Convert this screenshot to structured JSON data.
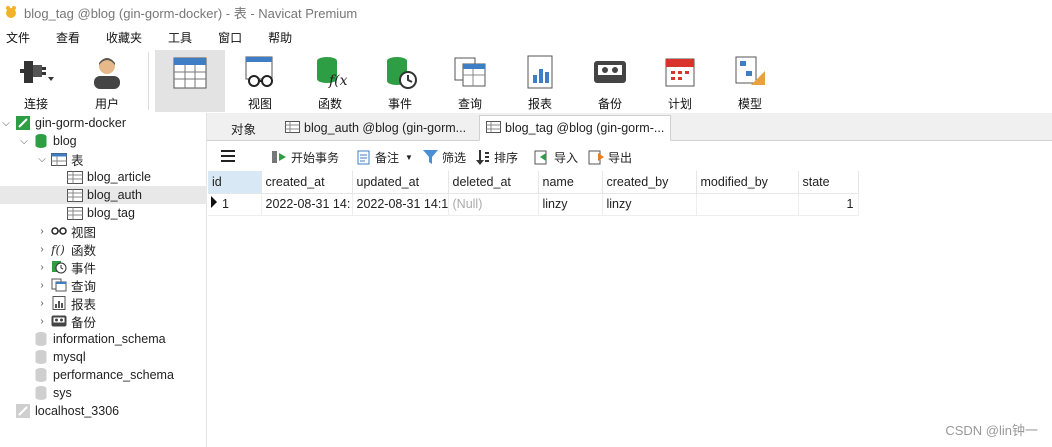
{
  "window": {
    "title": "blog_tag @blog (gin-gorm-docker) - 表 - Navicat Premium"
  },
  "menu": [
    "文件",
    "查看",
    "收藏夹",
    "工具",
    "窗口",
    "帮助"
  ],
  "toolbar": {
    "connect": "连接",
    "user": "用户",
    "table": "",
    "view": "视图",
    "function": "函数",
    "event": "事件",
    "query": "查询",
    "report": "报表",
    "backup": "备份",
    "schedule": "计划",
    "model": "模型"
  },
  "tree": {
    "connection": "gin-gorm-docker",
    "database": "blog",
    "tables_label": "表",
    "tables": [
      "blog_article",
      "blog_auth",
      "blog_tag"
    ],
    "view": "视图",
    "function": "函数",
    "event": "事件",
    "query": "查询",
    "report": "报表",
    "backup": "备份",
    "other_dbs": [
      "information_schema",
      "mysql",
      "performance_schema",
      "sys"
    ],
    "other_connection": "localhost_3306"
  },
  "tabs": {
    "objects": "对象",
    "tab1": "blog_auth @blog (gin-gorm...",
    "tab2": "blog_tag @blog (gin-gorm-..."
  },
  "subtoolbar": {
    "begin_tx": "开始事务",
    "memo": "备注",
    "filter": "筛选",
    "sort": "排序",
    "import": "导入",
    "export": "导出"
  },
  "grid": {
    "columns": [
      "id",
      "created_at",
      "updated_at",
      "deleted_at",
      "name",
      "created_by",
      "modified_by",
      "state"
    ],
    "row": [
      "1",
      "2022-08-31 14:",
      "2022-08-31 14:1",
      "(Null)",
      "linzy",
      "linzy",
      "",
      "1"
    ]
  },
  "watermark": "CSDN @lin钟一",
  "colors": {
    "accent": "#2e7d32",
    "db": "#2e9e44",
    "selected": "#e8e8e8"
  }
}
